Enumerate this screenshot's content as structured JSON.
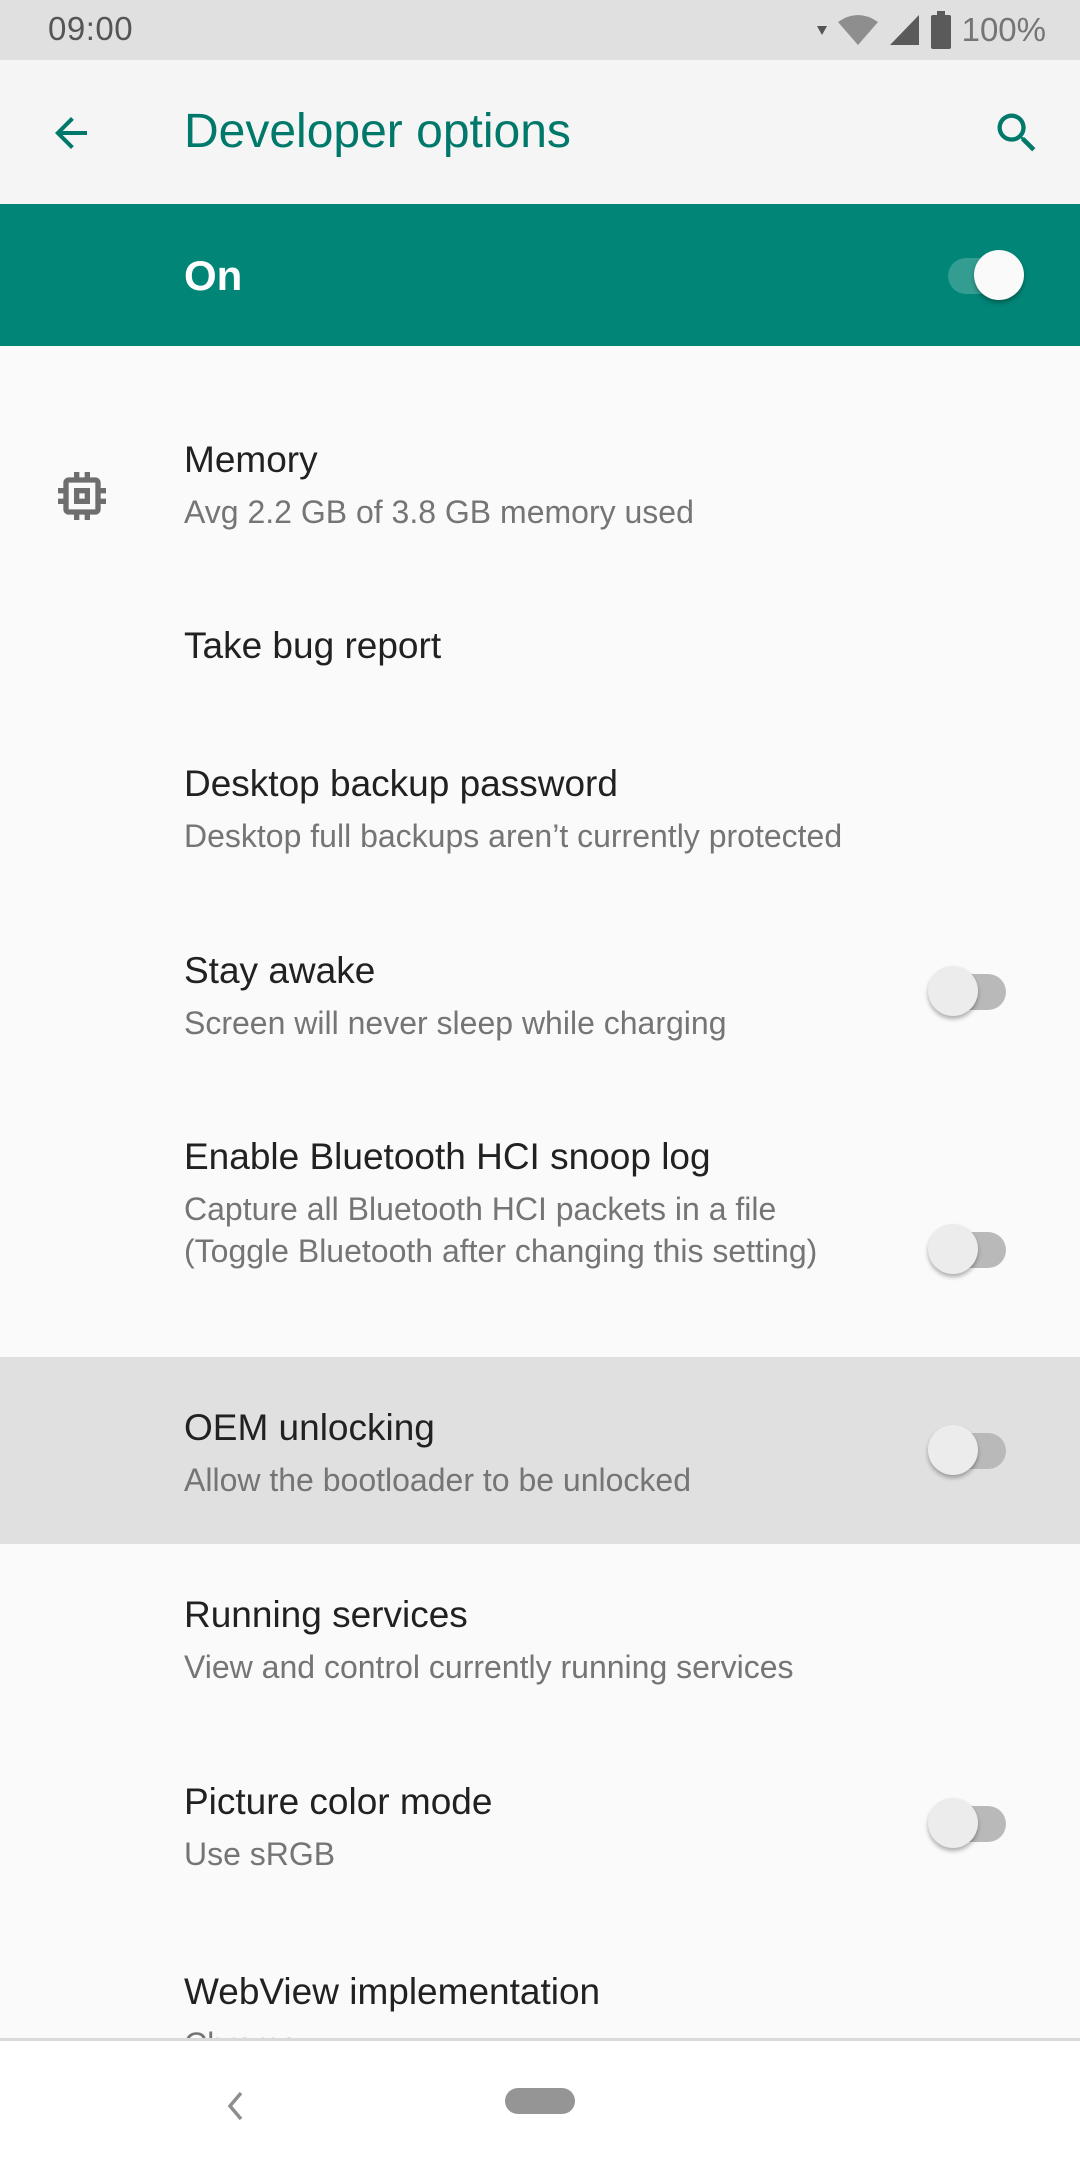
{
  "status_bar": {
    "time": "09:00",
    "battery_percent": "100%",
    "icons": [
      "data-arrow-icon",
      "wifi-icon",
      "cell-signal-icon",
      "battery-icon"
    ]
  },
  "app_bar": {
    "title": "Developer options",
    "back_icon": "arrow-back-icon",
    "search_icon": "search-icon"
  },
  "master_switch": {
    "label": "On",
    "checked": true
  },
  "colors": {
    "accent": "#00796B",
    "master_bar": "#008577",
    "background": "#FAFAFA",
    "highlight": "#E0E0E0"
  },
  "settings": [
    {
      "title": "Memory",
      "summary": "Avg 2.2 GB of 3.8 GB memory used",
      "icon": "memory-chip-icon"
    },
    {
      "title": "Take bug report"
    },
    {
      "title": "Desktop backup password",
      "summary": "Desktop full backups aren’t currently protected"
    },
    {
      "title": "Stay awake",
      "summary": "Screen will never sleep while charging",
      "toggle": false
    },
    {
      "title": "Enable Bluetooth HCI snoop log",
      "summary": "Capture all Bluetooth HCI packets in a file (Toggle Bluetooth after changing this setting)",
      "toggle": false
    },
    {
      "title": "OEM unlocking",
      "summary": "Allow the bootloader to be unlocked",
      "toggle": false,
      "highlighted": true
    },
    {
      "title": "Running services",
      "summary": "View and control currently running services"
    },
    {
      "title": "Picture color mode",
      "summary": "Use sRGB",
      "toggle": false
    },
    {
      "title": "WebView implementation",
      "summary": "Chrome"
    }
  ],
  "nav_bar": {
    "back_icon": "nav-back-icon",
    "home_icon": "nav-home-pill"
  }
}
